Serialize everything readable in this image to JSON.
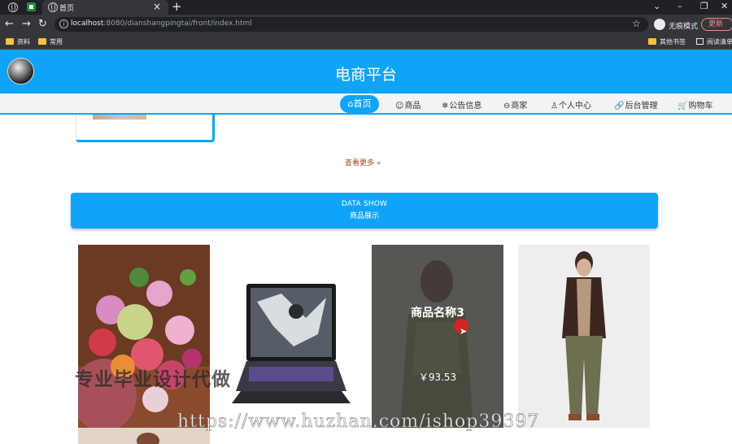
{
  "browser": {
    "tab_title": "首页",
    "url_host": "localhost",
    "url_rest": ":8080/dianshangpingtai/front/index.html",
    "incognito_label": "无痕模式",
    "update_label": "更新",
    "bookmarks": [
      "资料",
      "常用",
      "其他书签",
      "阅读清单"
    ]
  },
  "header": {
    "title": "电商平台"
  },
  "nav": {
    "home": "首页",
    "items": [
      "商品",
      "公告信息",
      "商家",
      "个人中心",
      "后台管理",
      "购物车"
    ]
  },
  "more": {
    "label": "查看更多"
  },
  "section": {
    "en": "DATA SHOW",
    "cn": "商品展示"
  },
  "products": [
    {
      "image": "flower-bouquet"
    },
    {
      "image": "gaming-laptop"
    },
    {
      "image": "green-pattern-dress",
      "name": "商品名称3",
      "price": "￥93.53"
    },
    {
      "image": "man-brown-jacket"
    }
  ],
  "watermarks": {
    "cn": "专业毕业设计代做",
    "url": "https://www.huzhan.com/ishop39397"
  },
  "colors": {
    "brand": "#0fa4f8",
    "link": "#a0452e"
  }
}
